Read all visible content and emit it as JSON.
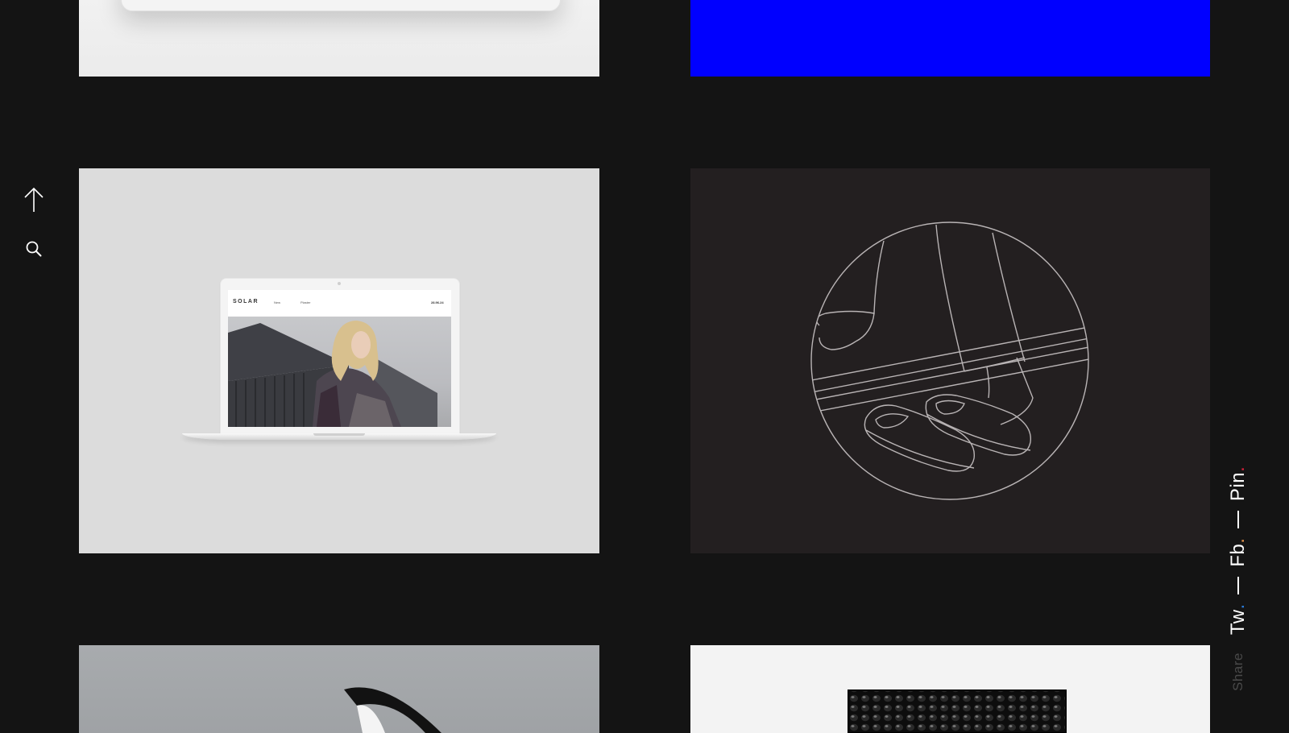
{
  "nav": {
    "up_icon": "arrow-up-icon",
    "search_icon": "search-icon"
  },
  "gallery": {
    "laptop_site": {
      "brand": "SOLAR",
      "nav_item_1": "New",
      "nav_item_2": "Plaster",
      "nav_item_3": "28.96.24"
    }
  },
  "share": {
    "label": "Share",
    "links": [
      {
        "label": "Tw",
        "dot": ".",
        "dot_color": "#2b7bd9"
      },
      {
        "label": "Fb",
        "dot": ".",
        "dot_color": "#e8944a"
      },
      {
        "label": "Pin",
        "dot": ".",
        "dot_color": "#d9213a"
      }
    ]
  },
  "colors": {
    "background": "#141414",
    "blue_tile": "#0000ff",
    "illustration_tile": "#231f20"
  }
}
